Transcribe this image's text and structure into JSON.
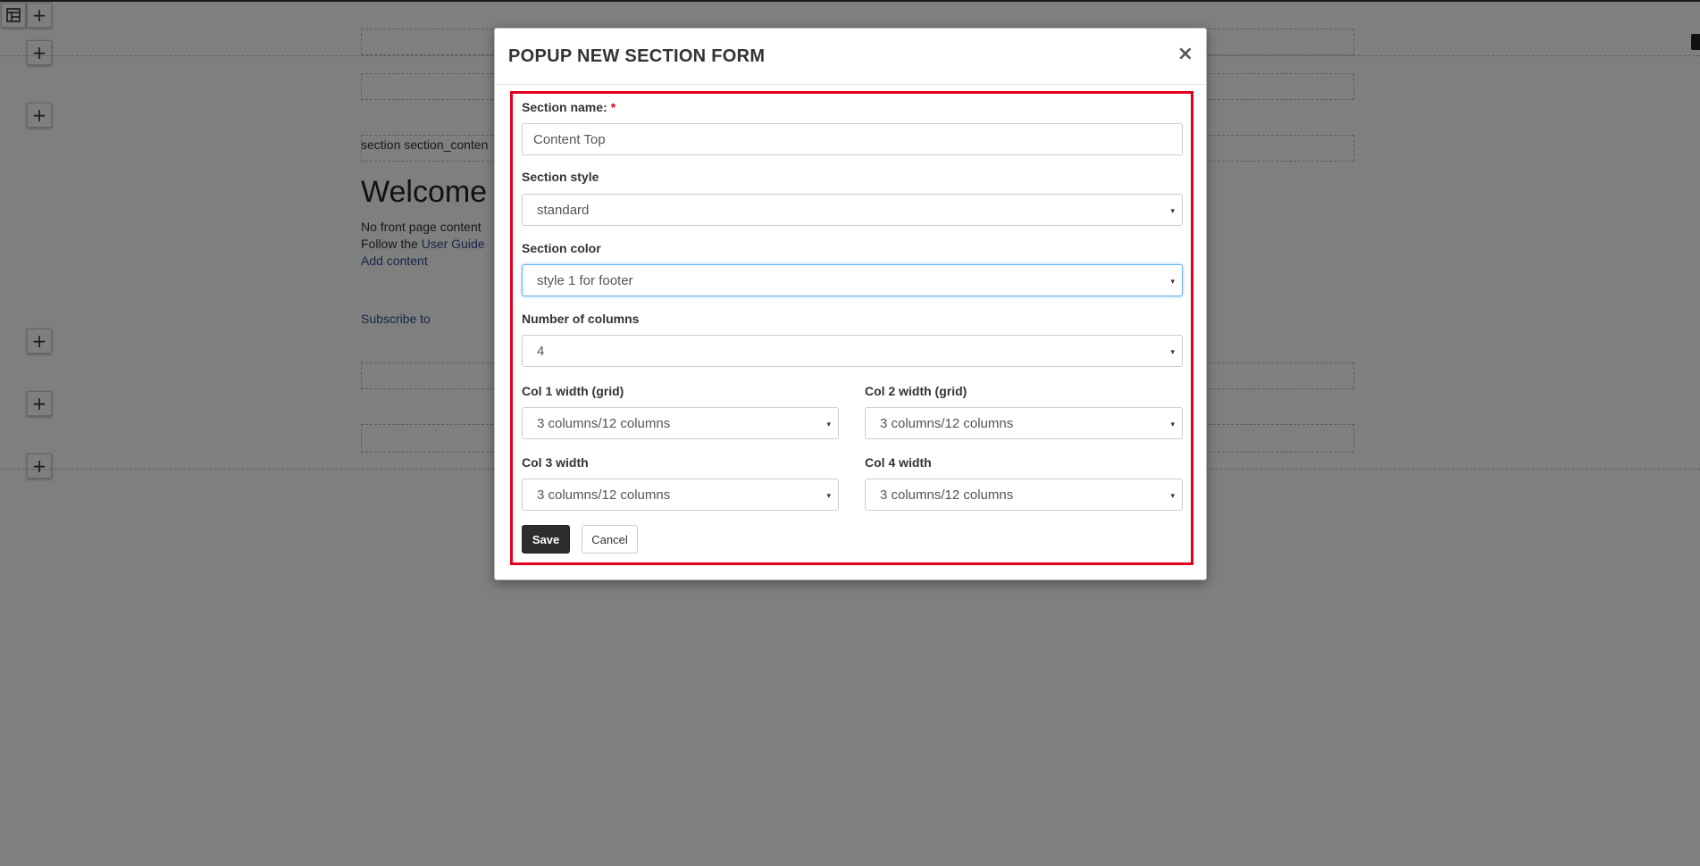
{
  "background": {
    "tools": [
      "+",
      "+",
      "+",
      "+",
      "+",
      "+"
    ],
    "section_label": "section section_conten",
    "welcome": "Welcome",
    "line1": "No front page content",
    "line2_prefix": "Follow the ",
    "line2_link": "User Guide",
    "add_content": "Add content",
    "subscribe": "Subscribe to"
  },
  "modal": {
    "title": "POPUP NEW SECTION FORM",
    "close": "×",
    "fields": {
      "section_name": {
        "label": "Section name:",
        "required": "*",
        "value": "Content Top"
      },
      "section_style": {
        "label": "Section style",
        "value": "standard"
      },
      "section_color": {
        "label": "Section color",
        "value": "style 1 for footer"
      },
      "num_columns": {
        "label": "Number of columns",
        "value": "4"
      },
      "col1": {
        "label": "Col 1 width (grid)",
        "value": "3 columns/12 columns"
      },
      "col2": {
        "label": "Col 2 width (grid)",
        "value": "3 columns/12 columns"
      },
      "col3": {
        "label": "Col 3 width",
        "value": "3 columns/12 columns"
      },
      "col4": {
        "label": "Col 4 width",
        "value": "3 columns/12 columns"
      }
    },
    "save_label": "Save",
    "cancel_label": "Cancel"
  },
  "icons": {
    "caret": "▾",
    "layout": "layout-icon"
  },
  "colors": {
    "highlight": "#e3001b",
    "focus": "#66afe9",
    "save_bg": "#2d2d2d"
  }
}
